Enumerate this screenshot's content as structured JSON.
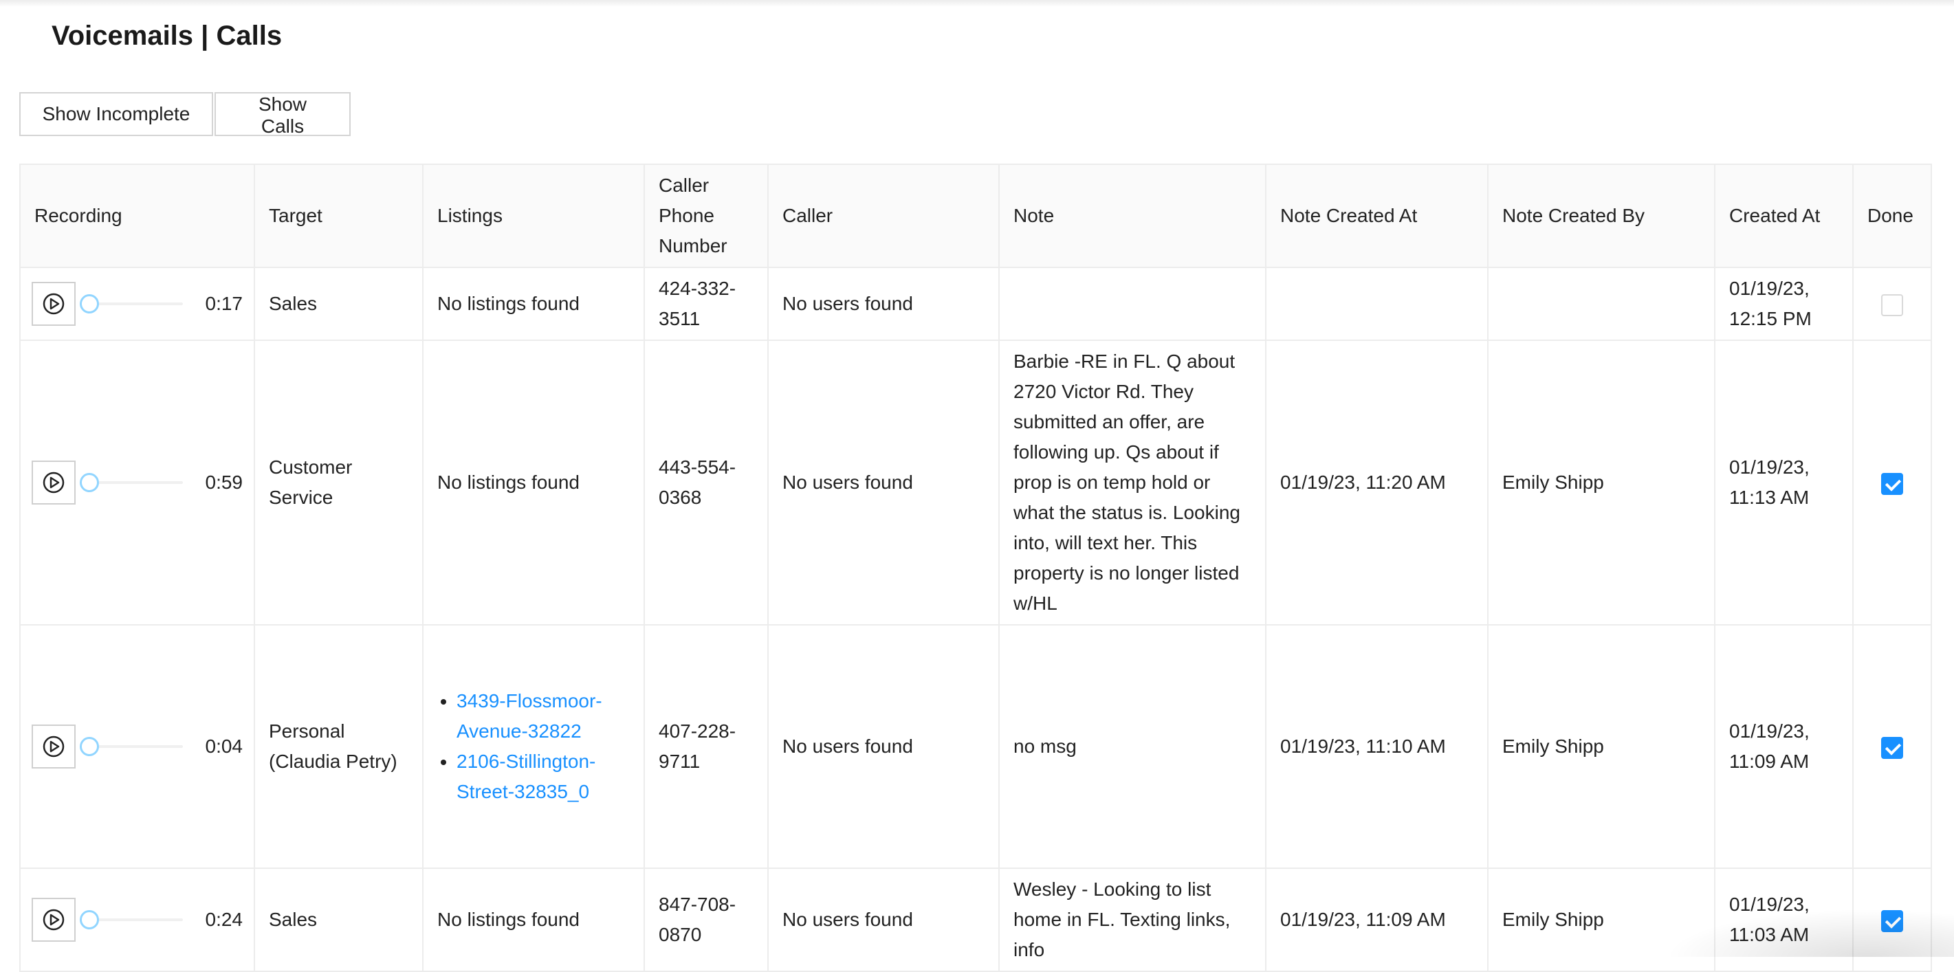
{
  "page": {
    "title": "Voicemails | Calls"
  },
  "filters": {
    "show_incomplete_label": "Show Incomplete",
    "show_calls_label": "Show Calls"
  },
  "table": {
    "headers": {
      "recording": "Recording",
      "target": "Target",
      "listings": "Listings",
      "caller_phone": "Caller Phone Number",
      "caller": "Caller",
      "note": "Note",
      "note_created_at": "Note Created At",
      "note_created_by": "Note Created By",
      "created_at": "Created At",
      "done": "Done"
    },
    "rows": [
      {
        "duration": "0:17",
        "progress": 0,
        "target": "Sales",
        "listings_text": "No listings found",
        "listings": [],
        "caller_phone": "424-332-3511",
        "caller": "No users found",
        "note": "",
        "note_created_at": "",
        "note_created_by": "",
        "created_at": "01/19/23, 12:15 PM",
        "done": false
      },
      {
        "duration": "0:59",
        "progress": 0,
        "target": "Customer Service",
        "listings_text": "No listings found",
        "listings": [],
        "caller_phone": "443-554-0368",
        "caller": "No users found",
        "note": "Barbie -RE in FL. Q about 2720 Victor Rd. They submitted an offer, are following up. Qs about if prop is on temp hold or what the status is. Looking into, will text her. This property is no longer listed w/HL",
        "note_created_at": "01/19/23, 11:20 AM",
        "note_created_by": "Emily Shipp",
        "created_at": "01/19/23, 11:13 AM",
        "done": true
      },
      {
        "duration": "0:04",
        "progress": 0,
        "target": "Personal (Claudia Petry)",
        "listings_text": "",
        "listings": [
          "3439-Flossmoor-Avenue-32822",
          "2106-Stillington-Street-32835_0"
        ],
        "caller_phone": "407-228-9711",
        "caller": "No users found",
        "note": "no msg",
        "note_created_at": "01/19/23, 11:10 AM",
        "note_created_by": "Emily Shipp",
        "created_at": "01/19/23, 11:09 AM",
        "done": true
      },
      {
        "duration": "0:24",
        "progress": 0,
        "target": "Sales",
        "listings_text": "No listings found",
        "listings": [],
        "caller_phone": "847-708-0870",
        "caller": "No users found",
        "note": "Wesley - Looking to list home in FL. Texting links, info",
        "note_created_at": "01/19/23, 11:09 AM",
        "note_created_by": "Emily Shipp",
        "created_at": "01/19/23, 11:03 AM",
        "done": true
      }
    ]
  },
  "icons": {
    "play": "play-circle-icon",
    "check": "checkbox-check-icon"
  },
  "colors": {
    "link": "#1890ff",
    "checkbox_checked": "#1890ff",
    "slider_accent": "#91d5ff"
  }
}
